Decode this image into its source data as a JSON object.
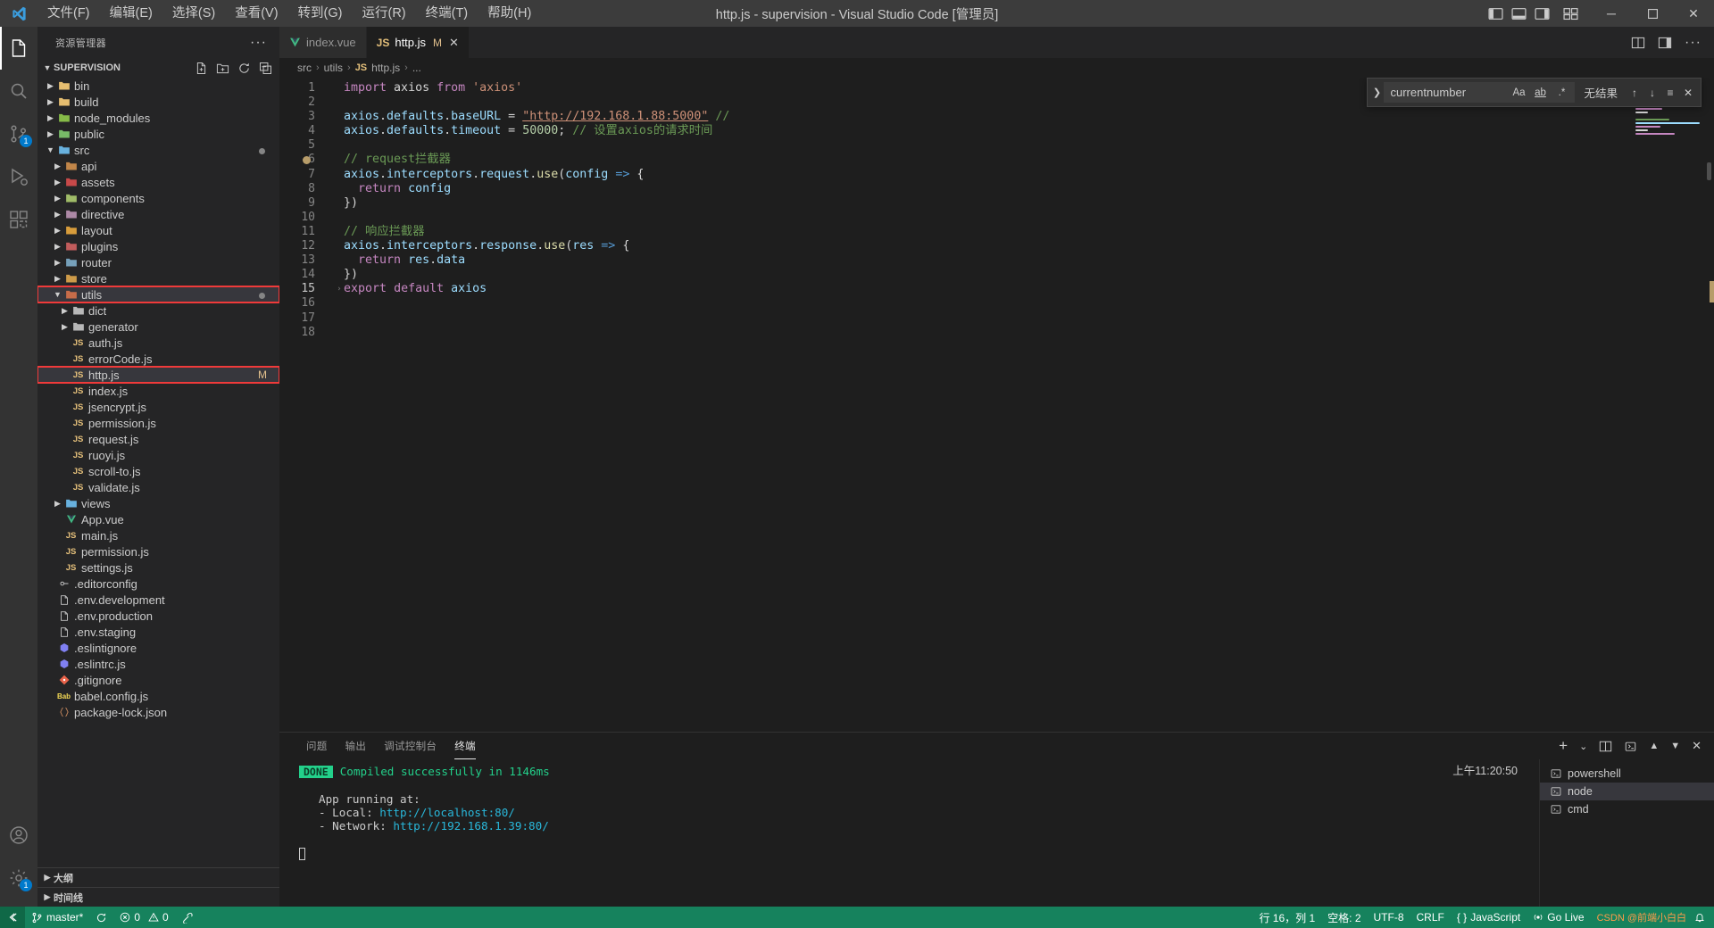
{
  "titlebar": {
    "title": "http.js - supervision - Visual Studio Code [管理员]",
    "menus": [
      "文件(F)",
      "编辑(E)",
      "选择(S)",
      "查看(V)",
      "转到(G)",
      "运行(R)",
      "终端(T)",
      "帮助(H)"
    ],
    "window_buttons": {
      "minimize": "─",
      "maximize": "☐",
      "close": "✕"
    }
  },
  "activitybar": {
    "items": [
      {
        "name": "explorer",
        "icon": "files-icon",
        "badge": ""
      },
      {
        "name": "search",
        "icon": "search-icon",
        "badge": ""
      },
      {
        "name": "source-control",
        "icon": "source-control-icon",
        "badge": "1"
      },
      {
        "name": "run-debug",
        "icon": "run-debug-icon",
        "badge": ""
      },
      {
        "name": "extensions",
        "icon": "extensions-icon",
        "badge": ""
      }
    ],
    "bottom": [
      {
        "name": "account",
        "icon": "account-icon",
        "badge": ""
      },
      {
        "name": "settings",
        "icon": "gear-icon",
        "badge": "1"
      }
    ]
  },
  "sidebar": {
    "header": "资源管理器",
    "more_label": "···",
    "project": "SUPERVISION",
    "tree": [
      {
        "label": "bin",
        "indent": 0,
        "type": "folder",
        "expanded": false,
        "icon_color": "#f0c674"
      },
      {
        "label": "build",
        "indent": 0,
        "type": "folder",
        "expanded": false,
        "icon_color": "#f0c674"
      },
      {
        "label": "node_modules",
        "indent": 0,
        "type": "folder",
        "expanded": false,
        "icon_color": "#8bc34a"
      },
      {
        "label": "public",
        "indent": 0,
        "type": "folder",
        "expanded": false,
        "icon_color": "#7cc36b"
      },
      {
        "label": "src",
        "indent": 0,
        "type": "folder",
        "expanded": true,
        "icon_color": "#6bb8e8",
        "dot": true
      },
      {
        "label": "api",
        "indent": 1,
        "type": "folder",
        "expanded": false,
        "icon_color": "#c98b4b"
      },
      {
        "label": "assets",
        "indent": 1,
        "type": "folder",
        "expanded": false,
        "icon_color": "#d14b4b"
      },
      {
        "label": "components",
        "indent": 1,
        "type": "folder",
        "expanded": false,
        "icon_color": "#a6c46c"
      },
      {
        "label": "directive",
        "indent": 1,
        "type": "folder",
        "expanded": false,
        "icon_color": "#b48ead"
      },
      {
        "label": "layout",
        "indent": 1,
        "type": "folder",
        "expanded": false,
        "icon_color": "#e0a23c"
      },
      {
        "label": "plugins",
        "indent": 1,
        "type": "folder",
        "expanded": false,
        "icon_color": "#c95f5f"
      },
      {
        "label": "router",
        "indent": 1,
        "type": "folder",
        "expanded": false,
        "icon_color": "#7aa6c2"
      },
      {
        "label": "store",
        "indent": 1,
        "type": "folder",
        "expanded": false,
        "icon_color": "#d6a14b"
      },
      {
        "label": "utils",
        "indent": 1,
        "type": "folder",
        "expanded": true,
        "icon_color": "#cf6f4a",
        "highlighted": true,
        "selected": true,
        "dot": true
      },
      {
        "label": "dict",
        "indent": 2,
        "type": "folder",
        "expanded": false,
        "icon_color": "#c0c0c0"
      },
      {
        "label": "generator",
        "indent": 2,
        "type": "folder",
        "expanded": false,
        "icon_color": "#c0c0c0"
      },
      {
        "label": "auth.js",
        "indent": 2,
        "type": "js"
      },
      {
        "label": "errorCode.js",
        "indent": 2,
        "type": "js"
      },
      {
        "label": "http.js",
        "indent": 2,
        "type": "js",
        "highlighted": true,
        "selected": true,
        "modified": "M"
      },
      {
        "label": "index.js",
        "indent": 2,
        "type": "js"
      },
      {
        "label": "jsencrypt.js",
        "indent": 2,
        "type": "js"
      },
      {
        "label": "permission.js",
        "indent": 2,
        "type": "js"
      },
      {
        "label": "request.js",
        "indent": 2,
        "type": "js"
      },
      {
        "label": "ruoyi.js",
        "indent": 2,
        "type": "js"
      },
      {
        "label": "scroll-to.js",
        "indent": 2,
        "type": "js"
      },
      {
        "label": "validate.js",
        "indent": 2,
        "type": "js"
      },
      {
        "label": "views",
        "indent": 1,
        "type": "folder",
        "expanded": false,
        "icon_color": "#6bb8e8"
      },
      {
        "label": "App.vue",
        "indent": 1,
        "type": "vue"
      },
      {
        "label": "main.js",
        "indent": 1,
        "type": "js"
      },
      {
        "label": "permission.js",
        "indent": 1,
        "type": "js"
      },
      {
        "label": "settings.js",
        "indent": 1,
        "type": "js"
      },
      {
        "label": ".editorconfig",
        "indent": 0,
        "type": "config"
      },
      {
        "label": ".env.development",
        "indent": 0,
        "type": "file"
      },
      {
        "label": ".env.production",
        "indent": 0,
        "type": "file"
      },
      {
        "label": ".env.staging",
        "indent": 0,
        "type": "file"
      },
      {
        "label": ".eslintignore",
        "indent": 0,
        "type": "eslint"
      },
      {
        "label": ".eslintrc.js",
        "indent": 0,
        "type": "eslint"
      },
      {
        "label": ".gitignore",
        "indent": 0,
        "type": "git"
      },
      {
        "label": "babel.config.js",
        "indent": 0,
        "type": "babel"
      },
      {
        "label": "package-lock.json",
        "indent": 0,
        "type": "json"
      }
    ],
    "bottom_sections": [
      "大纲",
      "时间线"
    ]
  },
  "editor": {
    "tabs": [
      {
        "label": "index.vue",
        "icon": "vue-icon",
        "active": false,
        "dirty": false
      },
      {
        "label": "http.js",
        "icon": "js-icon",
        "active": true,
        "dirty": true,
        "dirty_mark": "M",
        "close": "✕"
      }
    ],
    "breadcrumb": [
      "src",
      "utils",
      "http.js",
      "..."
    ],
    "breadcrumb_sep": "›",
    "breadcrumb_file_icon": "JS",
    "lines": [
      {
        "n": 1,
        "tokens": [
          {
            "t": "import",
            "c": "kw"
          },
          {
            "t": " axios ",
            "c": "plain"
          },
          {
            "t": "from",
            "c": "kw"
          },
          {
            "t": " ",
            "c": "plain"
          },
          {
            "t": "'axios'",
            "c": "str"
          }
        ]
      },
      {
        "n": 2,
        "tokens": []
      },
      {
        "n": 3,
        "tokens": [
          {
            "t": "axios",
            "c": "var"
          },
          {
            "t": ".",
            "c": "plain"
          },
          {
            "t": "defaults",
            "c": "var"
          },
          {
            "t": ".",
            "c": "plain"
          },
          {
            "t": "baseURL",
            "c": "var"
          },
          {
            "t": " = ",
            "c": "plain"
          },
          {
            "t": "\"http://192.168.1.88:5000\"",
            "c": "link"
          },
          {
            "t": " ",
            "c": "plain"
          },
          {
            "t": "//",
            "c": "cmt"
          }
        ]
      },
      {
        "n": 4,
        "tokens": [
          {
            "t": "axios",
            "c": "var"
          },
          {
            "t": ".",
            "c": "plain"
          },
          {
            "t": "defaults",
            "c": "var"
          },
          {
            "t": ".",
            "c": "plain"
          },
          {
            "t": "timeout",
            "c": "var"
          },
          {
            "t": " = ",
            "c": "plain"
          },
          {
            "t": "50000",
            "c": "num"
          },
          {
            "t": "; ",
            "c": "plain"
          },
          {
            "t": "// 设置axios的请求时间",
            "c": "cmt"
          }
        ]
      },
      {
        "n": 5,
        "tokens": []
      },
      {
        "n": 6,
        "tokens": [
          {
            "t": "// request拦截器",
            "c": "cmt"
          }
        ],
        "breakpoint": true
      },
      {
        "n": 7,
        "tokens": [
          {
            "t": "axios",
            "c": "var"
          },
          {
            "t": ".",
            "c": "plain"
          },
          {
            "t": "interceptors",
            "c": "var"
          },
          {
            "t": ".",
            "c": "plain"
          },
          {
            "t": "request",
            "c": "var"
          },
          {
            "t": ".",
            "c": "plain"
          },
          {
            "t": "use",
            "c": "fn"
          },
          {
            "t": "(",
            "c": "plain"
          },
          {
            "t": "config",
            "c": "var"
          },
          {
            "t": " ",
            "c": "plain"
          },
          {
            "t": "=>",
            "c": "kw2"
          },
          {
            "t": " {",
            "c": "plain"
          }
        ]
      },
      {
        "n": 8,
        "tokens": [
          {
            "t": "  ",
            "c": "plain"
          },
          {
            "t": "return",
            "c": "kw"
          },
          {
            "t": " ",
            "c": "plain"
          },
          {
            "t": "config",
            "c": "var"
          }
        ]
      },
      {
        "n": 9,
        "tokens": [
          {
            "t": "})",
            "c": "plain"
          }
        ]
      },
      {
        "n": 10,
        "tokens": []
      },
      {
        "n": 11,
        "tokens": [
          {
            "t": "// 响应拦截器",
            "c": "cmt"
          }
        ]
      },
      {
        "n": 12,
        "tokens": [
          {
            "t": "axios",
            "c": "var"
          },
          {
            "t": ".",
            "c": "plain"
          },
          {
            "t": "interceptors",
            "c": "var"
          },
          {
            "t": ".",
            "c": "plain"
          },
          {
            "t": "response",
            "c": "var"
          },
          {
            "t": ".",
            "c": "plain"
          },
          {
            "t": "use",
            "c": "fn"
          },
          {
            "t": "(",
            "c": "plain"
          },
          {
            "t": "res",
            "c": "var"
          },
          {
            "t": " ",
            "c": "plain"
          },
          {
            "t": "=>",
            "c": "kw2"
          },
          {
            "t": " {",
            "c": "plain"
          }
        ]
      },
      {
        "n": 13,
        "tokens": [
          {
            "t": "  ",
            "c": "plain"
          },
          {
            "t": "return",
            "c": "kw"
          },
          {
            "t": " ",
            "c": "plain"
          },
          {
            "t": "res",
            "c": "var"
          },
          {
            "t": ".",
            "c": "plain"
          },
          {
            "t": "data",
            "c": "var"
          }
        ]
      },
      {
        "n": 14,
        "tokens": [
          {
            "t": "})",
            "c": "plain"
          }
        ]
      },
      {
        "n": 15,
        "tokens": [
          {
            "t": "export",
            "c": "kw"
          },
          {
            "t": " ",
            "c": "plain"
          },
          {
            "t": "default",
            "c": "kw"
          },
          {
            "t": " ",
            "c": "plain"
          },
          {
            "t": "axios",
            "c": "var"
          }
        ],
        "current": true,
        "fold": "›"
      },
      {
        "n": 16,
        "tokens": []
      },
      {
        "n": 17,
        "tokens": []
      },
      {
        "n": 18,
        "tokens": []
      }
    ]
  },
  "find_widget": {
    "toggle_icon": "chevron-right-icon",
    "query": "currentnumber",
    "match_case": "Aa",
    "whole_word": "ab",
    "use_regex": ".*",
    "result": "无结果",
    "prev": "↑",
    "next": "↓",
    "find_in_selection": "≡",
    "close": "✕"
  },
  "panel": {
    "tabs": [
      "问题",
      "输出",
      "调试控制台",
      "终端"
    ],
    "active_tab": "终端",
    "actions": {
      "new": "+",
      "split": "⎘",
      "chevron": "⌄",
      "maximize": "⌃",
      "minimize": "⌄",
      "close": "✕"
    },
    "terminal": {
      "badge": "DONE",
      "compiled": "Compiled successfully in 1146ms",
      "time": "上午11:20:50",
      "app_running": "App running at:",
      "local_label": "  - Local:   ",
      "local_url": "http://localhost:80/",
      "network_label": "  - Network: ",
      "network_url": "http://192.168.1.39:80/"
    },
    "terminal_list": [
      {
        "label": "powershell",
        "icon": "terminal-icon",
        "active": false
      },
      {
        "label": "node",
        "icon": "terminal-icon",
        "active": true
      },
      {
        "label": "cmd",
        "icon": "terminal-icon",
        "active": false
      }
    ]
  },
  "statusbar": {
    "branch": "master*",
    "sync_icon": "sync-icon",
    "errors": "0",
    "warnings": "0",
    "ports_icon": "ports-icon",
    "position": "行 16，列 1",
    "spaces": "空格: 2",
    "encoding": "UTF-8",
    "eol": "CRLF",
    "language": "JavaScript",
    "golive": "Go Live",
    "bell": "🔔",
    "watermark": "CSDN @前端小白白"
  },
  "colors": {
    "accent": "#007acc",
    "statusbar_bg": "#16825d",
    "highlight_box": "#f03a3a",
    "modified": "#e2c08d",
    "done_badge": "#23d18b"
  }
}
